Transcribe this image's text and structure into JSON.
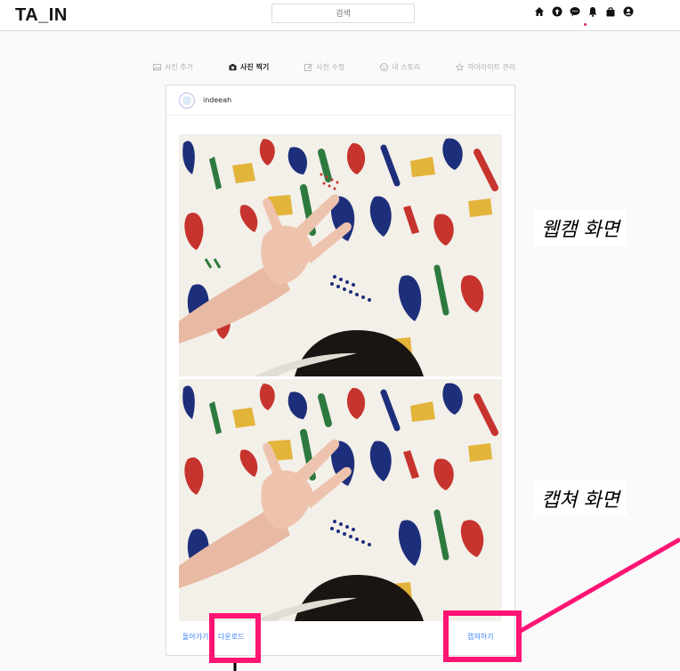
{
  "app": {
    "logo": "TA_IN"
  },
  "search": {
    "placeholder": "검색"
  },
  "nav": {
    "icons": [
      "home-icon",
      "upload-icon",
      "message-icon",
      "notification-icon",
      "bag-icon",
      "profile-icon"
    ]
  },
  "tabs": [
    {
      "label": "사진 추가",
      "icon": "image-icon",
      "active": false
    },
    {
      "label": "사진 찍기",
      "icon": "camera-icon",
      "active": true
    },
    {
      "label": "사진 수정",
      "icon": "edit-icon",
      "active": false
    },
    {
      "label": "내 스토리",
      "icon": "smile-icon",
      "active": false
    },
    {
      "label": "하이라이트 관리",
      "icon": "star-icon",
      "active": false
    }
  ],
  "post": {
    "username": "indeeah",
    "back_label": "돌아가기",
    "download_label": "다운로드",
    "capture_label": "캡쳐하기"
  },
  "annotations": {
    "webcam": "웹캠 화면",
    "capture": "캡쳐 화면"
  },
  "colors": {
    "highlight": "#ff1474",
    "link": "#3b82f6",
    "accent_dot": "#e0245e"
  }
}
